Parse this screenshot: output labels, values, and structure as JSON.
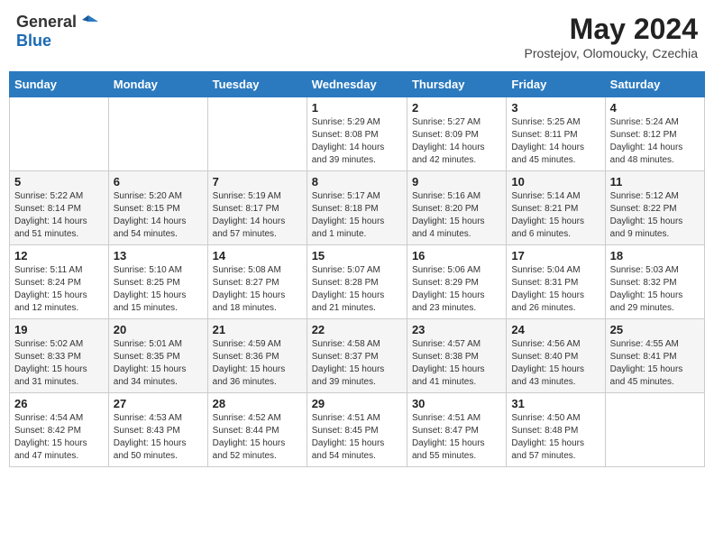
{
  "header": {
    "logo_general": "General",
    "logo_blue": "Blue",
    "month_title": "May 2024",
    "location": "Prostejov, Olomoucky, Czechia"
  },
  "days_of_week": [
    "Sunday",
    "Monday",
    "Tuesday",
    "Wednesday",
    "Thursday",
    "Friday",
    "Saturday"
  ],
  "weeks": [
    {
      "days": [
        {
          "number": "",
          "info": ""
        },
        {
          "number": "",
          "info": ""
        },
        {
          "number": "",
          "info": ""
        },
        {
          "number": "1",
          "info": "Sunrise: 5:29 AM\nSunset: 8:08 PM\nDaylight: 14 hours\nand 39 minutes."
        },
        {
          "number": "2",
          "info": "Sunrise: 5:27 AM\nSunset: 8:09 PM\nDaylight: 14 hours\nand 42 minutes."
        },
        {
          "number": "3",
          "info": "Sunrise: 5:25 AM\nSunset: 8:11 PM\nDaylight: 14 hours\nand 45 minutes."
        },
        {
          "number": "4",
          "info": "Sunrise: 5:24 AM\nSunset: 8:12 PM\nDaylight: 14 hours\nand 48 minutes."
        }
      ]
    },
    {
      "days": [
        {
          "number": "5",
          "info": "Sunrise: 5:22 AM\nSunset: 8:14 PM\nDaylight: 14 hours\nand 51 minutes."
        },
        {
          "number": "6",
          "info": "Sunrise: 5:20 AM\nSunset: 8:15 PM\nDaylight: 14 hours\nand 54 minutes."
        },
        {
          "number": "7",
          "info": "Sunrise: 5:19 AM\nSunset: 8:17 PM\nDaylight: 14 hours\nand 57 minutes."
        },
        {
          "number": "8",
          "info": "Sunrise: 5:17 AM\nSunset: 8:18 PM\nDaylight: 15 hours\nand 1 minute."
        },
        {
          "number": "9",
          "info": "Sunrise: 5:16 AM\nSunset: 8:20 PM\nDaylight: 15 hours\nand 4 minutes."
        },
        {
          "number": "10",
          "info": "Sunrise: 5:14 AM\nSunset: 8:21 PM\nDaylight: 15 hours\nand 6 minutes."
        },
        {
          "number": "11",
          "info": "Sunrise: 5:12 AM\nSunset: 8:22 PM\nDaylight: 15 hours\nand 9 minutes."
        }
      ]
    },
    {
      "days": [
        {
          "number": "12",
          "info": "Sunrise: 5:11 AM\nSunset: 8:24 PM\nDaylight: 15 hours\nand 12 minutes."
        },
        {
          "number": "13",
          "info": "Sunrise: 5:10 AM\nSunset: 8:25 PM\nDaylight: 15 hours\nand 15 minutes."
        },
        {
          "number": "14",
          "info": "Sunrise: 5:08 AM\nSunset: 8:27 PM\nDaylight: 15 hours\nand 18 minutes."
        },
        {
          "number": "15",
          "info": "Sunrise: 5:07 AM\nSunset: 8:28 PM\nDaylight: 15 hours\nand 21 minutes."
        },
        {
          "number": "16",
          "info": "Sunrise: 5:06 AM\nSunset: 8:29 PM\nDaylight: 15 hours\nand 23 minutes."
        },
        {
          "number": "17",
          "info": "Sunrise: 5:04 AM\nSunset: 8:31 PM\nDaylight: 15 hours\nand 26 minutes."
        },
        {
          "number": "18",
          "info": "Sunrise: 5:03 AM\nSunset: 8:32 PM\nDaylight: 15 hours\nand 29 minutes."
        }
      ]
    },
    {
      "days": [
        {
          "number": "19",
          "info": "Sunrise: 5:02 AM\nSunset: 8:33 PM\nDaylight: 15 hours\nand 31 minutes."
        },
        {
          "number": "20",
          "info": "Sunrise: 5:01 AM\nSunset: 8:35 PM\nDaylight: 15 hours\nand 34 minutes."
        },
        {
          "number": "21",
          "info": "Sunrise: 4:59 AM\nSunset: 8:36 PM\nDaylight: 15 hours\nand 36 minutes."
        },
        {
          "number": "22",
          "info": "Sunrise: 4:58 AM\nSunset: 8:37 PM\nDaylight: 15 hours\nand 39 minutes."
        },
        {
          "number": "23",
          "info": "Sunrise: 4:57 AM\nSunset: 8:38 PM\nDaylight: 15 hours\nand 41 minutes."
        },
        {
          "number": "24",
          "info": "Sunrise: 4:56 AM\nSunset: 8:40 PM\nDaylight: 15 hours\nand 43 minutes."
        },
        {
          "number": "25",
          "info": "Sunrise: 4:55 AM\nSunset: 8:41 PM\nDaylight: 15 hours\nand 45 minutes."
        }
      ]
    },
    {
      "days": [
        {
          "number": "26",
          "info": "Sunrise: 4:54 AM\nSunset: 8:42 PM\nDaylight: 15 hours\nand 47 minutes."
        },
        {
          "number": "27",
          "info": "Sunrise: 4:53 AM\nSunset: 8:43 PM\nDaylight: 15 hours\nand 50 minutes."
        },
        {
          "number": "28",
          "info": "Sunrise: 4:52 AM\nSunset: 8:44 PM\nDaylight: 15 hours\nand 52 minutes."
        },
        {
          "number": "29",
          "info": "Sunrise: 4:51 AM\nSunset: 8:45 PM\nDaylight: 15 hours\nand 54 minutes."
        },
        {
          "number": "30",
          "info": "Sunrise: 4:51 AM\nSunset: 8:47 PM\nDaylight: 15 hours\nand 55 minutes."
        },
        {
          "number": "31",
          "info": "Sunrise: 4:50 AM\nSunset: 8:48 PM\nDaylight: 15 hours\nand 57 minutes."
        },
        {
          "number": "",
          "info": ""
        }
      ]
    }
  ]
}
